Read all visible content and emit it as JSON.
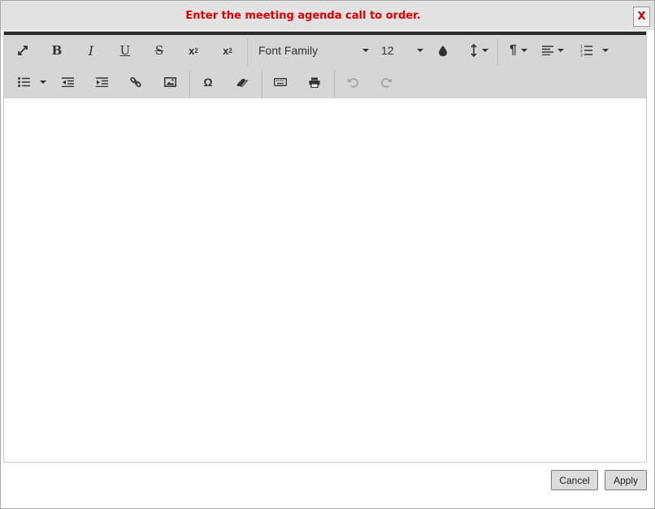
{
  "dialog": {
    "title": "Enter the meeting agenda call to order.",
    "close_label": "X"
  },
  "toolbar": {
    "bold_label": "B",
    "italic_label": "I",
    "underline_label": "U",
    "strike_label": "S",
    "subscript_label": "x",
    "subscript_mark": "2",
    "superscript_label": "x",
    "superscript_mark": "2",
    "font_family": "Font Family",
    "font_size": "12",
    "special_char_label": "Ω",
    "paragraph_label": "¶"
  },
  "editor": {
    "content": ""
  },
  "footer": {
    "cancel_label": "Cancel",
    "apply_label": "Apply"
  },
  "colors": {
    "title": "#e00000",
    "toolbar_bg": "#d6d6d6",
    "toolbar_top_border": "#2a2a2a"
  }
}
